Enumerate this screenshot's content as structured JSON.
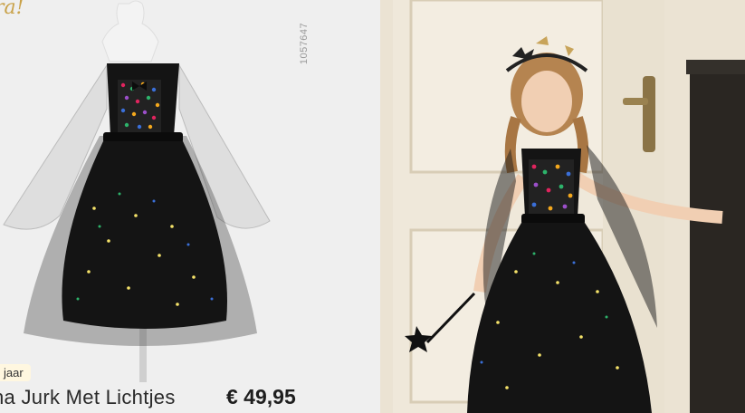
{
  "product": {
    "sku": "1057647",
    "age_label": "jaar",
    "title": "na Jurk Met Lichtjes",
    "price": "€ 49,95",
    "decor_text": "ra!"
  },
  "colors": {
    "price_text": "#1e1e1e",
    "dress_black": "#111111",
    "sequins": [
      "#e0245e",
      "#f4a81d",
      "#2db36b",
      "#3a6fd8",
      "#9b4fc9"
    ],
    "light_dots": "#f6e36a"
  }
}
